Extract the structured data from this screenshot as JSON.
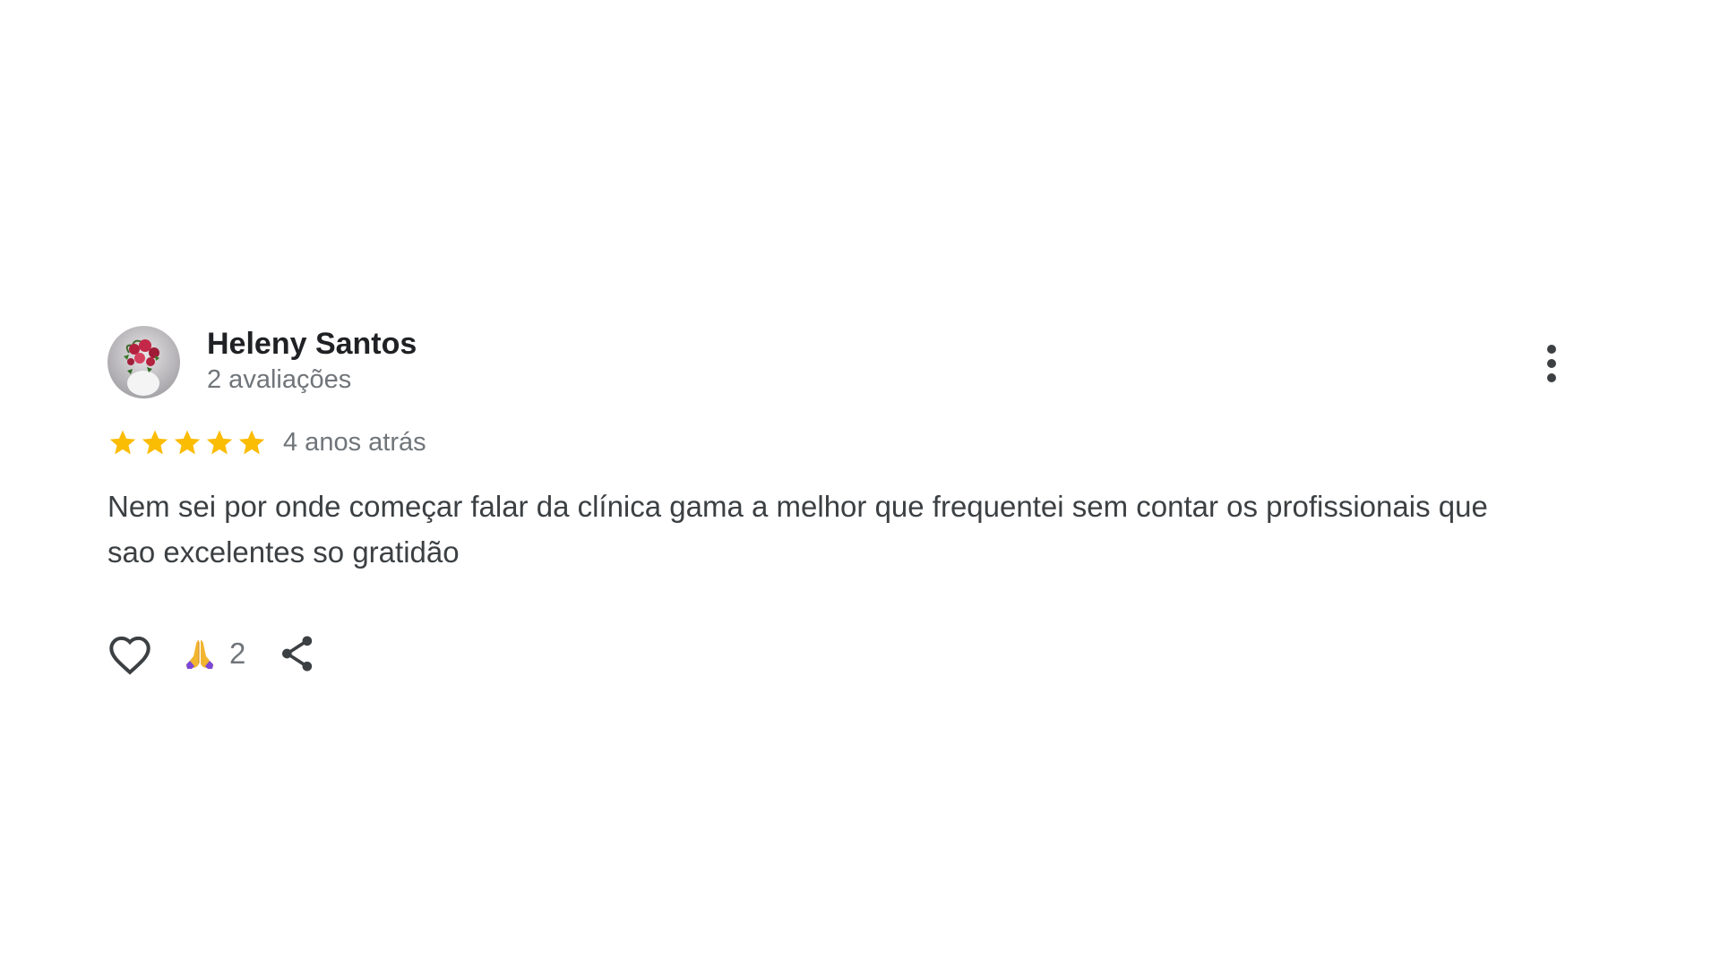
{
  "review": {
    "author": {
      "name": "Heleny Santos",
      "meta": "2 avaliações",
      "avatar_icon": "avatar-flower-bouquet-photo"
    },
    "rating": {
      "stars": 5,
      "max_stars": 5,
      "star_color": "#fbbc04"
    },
    "date": "4 anos atrás",
    "text": "Nem sei por onde começar falar da clínica gama a melhor que frequentei sem contar os profissionais que sao excelentes so gratidão",
    "actions": {
      "like_icon": "heart-outline-icon",
      "reaction_icon": "folded-hands-emoji",
      "reaction_count": "2",
      "share_icon": "share-icon",
      "more_icon": "more-vert-icon"
    }
  },
  "colors": {
    "name": "#202124",
    "meta": "#70757a",
    "body": "#3c4043",
    "icon": "#3c4043"
  }
}
